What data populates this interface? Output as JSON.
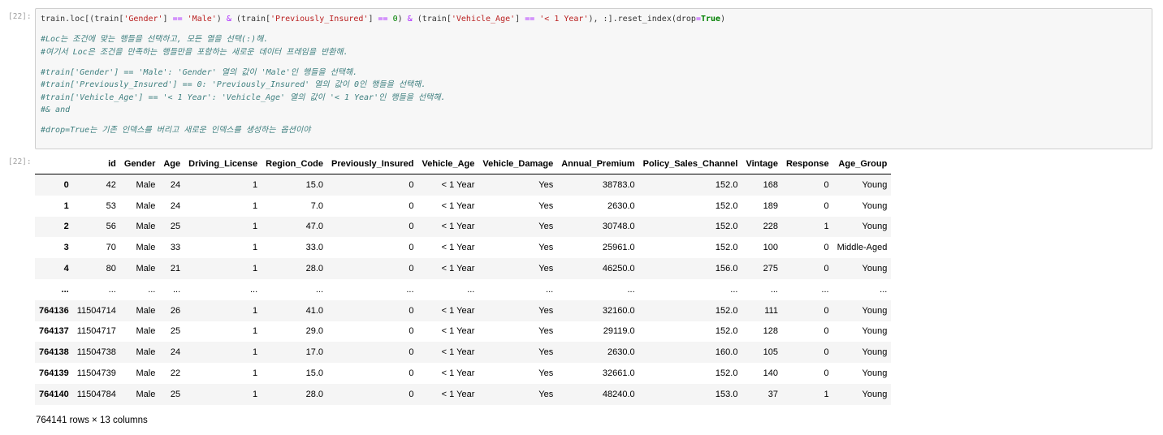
{
  "input_prompt": "[22]:",
  "output_prompt": "[22]:",
  "code_lines": [
    {
      "type": "code",
      "parts": [
        {
          "t": "train.loc[(train[",
          "c": ""
        },
        {
          "t": "'Gender'",
          "c": "s"
        },
        {
          "t": "] ",
          "c": ""
        },
        {
          "t": "==",
          "c": "o"
        },
        {
          "t": " ",
          "c": ""
        },
        {
          "t": "'Male'",
          "c": "s"
        },
        {
          "t": ") ",
          "c": ""
        },
        {
          "t": "&",
          "c": "o"
        },
        {
          "t": " (train[",
          "c": ""
        },
        {
          "t": "'Previously_Insured'",
          "c": "s"
        },
        {
          "t": "] ",
          "c": ""
        },
        {
          "t": "==",
          "c": "o"
        },
        {
          "t": " ",
          "c": ""
        },
        {
          "t": "0",
          "c": "m"
        },
        {
          "t": ") ",
          "c": ""
        },
        {
          "t": "&",
          "c": "o"
        },
        {
          "t": " (train[",
          "c": ""
        },
        {
          "t": "'Vehicle_Age'",
          "c": "s"
        },
        {
          "t": "] ",
          "c": ""
        },
        {
          "t": "==",
          "c": "o"
        },
        {
          "t": " ",
          "c": ""
        },
        {
          "t": "'< 1 Year'",
          "c": "s"
        },
        {
          "t": "), :].reset_index(drop",
          "c": ""
        },
        {
          "t": "=",
          "c": "o"
        },
        {
          "t": "True",
          "c": "k"
        },
        {
          "t": ")",
          "c": ""
        }
      ]
    },
    {
      "type": "blank"
    },
    {
      "type": "comment",
      "text": "#Loc는 조건에 맞는 행들을 선택하고, 모든 열을 선택(:)해."
    },
    {
      "type": "comment",
      "text": "#여기서 Loc은 조건을 만족하는 행들만을 포함하는 새로운 데이터 프레임을 반환해."
    },
    {
      "type": "blank"
    },
    {
      "type": "comment",
      "text": "#train['Gender'] == 'Male': 'Gender' 열의 값이 'Male'인 행들을 선택해."
    },
    {
      "type": "comment",
      "text": "#train['Previously_Insured'] == 0: 'Previously_Insured' 열의 값이 0인 행들을 선택해."
    },
    {
      "type": "comment",
      "text": "#train['Vehicle_Age'] == '< 1 Year': 'Vehicle_Age' 열의 값이 '< 1 Year'인 행들을 선택해."
    },
    {
      "type": "comment",
      "text": "#& and"
    },
    {
      "type": "blank"
    },
    {
      "type": "comment",
      "text": "#drop=True는 기존 인덱스를 버리고 새로운 인덱스를 생성하는 옵션이야"
    }
  ],
  "table": {
    "columns": [
      "id",
      "Gender",
      "Age",
      "Driving_License",
      "Region_Code",
      "Previously_Insured",
      "Vehicle_Age",
      "Vehicle_Damage",
      "Annual_Premium",
      "Policy_Sales_Channel",
      "Vintage",
      "Response",
      "Age_Group"
    ],
    "rows": [
      {
        "index": "0",
        "cells": [
          "42",
          "Male",
          "24",
          "1",
          "15.0",
          "0",
          "< 1 Year",
          "Yes",
          "38783.0",
          "152.0",
          "168",
          "0",
          "Young"
        ]
      },
      {
        "index": "1",
        "cells": [
          "53",
          "Male",
          "24",
          "1",
          "7.0",
          "0",
          "< 1 Year",
          "Yes",
          "2630.0",
          "152.0",
          "189",
          "0",
          "Young"
        ]
      },
      {
        "index": "2",
        "cells": [
          "56",
          "Male",
          "25",
          "1",
          "47.0",
          "0",
          "< 1 Year",
          "Yes",
          "30748.0",
          "152.0",
          "228",
          "1",
          "Young"
        ]
      },
      {
        "index": "3",
        "cells": [
          "70",
          "Male",
          "33",
          "1",
          "33.0",
          "0",
          "< 1 Year",
          "Yes",
          "25961.0",
          "152.0",
          "100",
          "0",
          "Middle-Aged"
        ]
      },
      {
        "index": "4",
        "cells": [
          "80",
          "Male",
          "21",
          "1",
          "28.0",
          "0",
          "< 1 Year",
          "Yes",
          "46250.0",
          "156.0",
          "275",
          "0",
          "Young"
        ]
      },
      {
        "index": "...",
        "cells": [
          "...",
          "...",
          "...",
          "...",
          "...",
          "...",
          "...",
          "...",
          "...",
          "...",
          "...",
          "...",
          "..."
        ]
      },
      {
        "index": "764136",
        "cells": [
          "11504714",
          "Male",
          "26",
          "1",
          "41.0",
          "0",
          "< 1 Year",
          "Yes",
          "32160.0",
          "152.0",
          "111",
          "0",
          "Young"
        ]
      },
      {
        "index": "764137",
        "cells": [
          "11504717",
          "Male",
          "25",
          "1",
          "29.0",
          "0",
          "< 1 Year",
          "Yes",
          "29119.0",
          "152.0",
          "128",
          "0",
          "Young"
        ]
      },
      {
        "index": "764138",
        "cells": [
          "11504738",
          "Male",
          "24",
          "1",
          "17.0",
          "0",
          "< 1 Year",
          "Yes",
          "2630.0",
          "160.0",
          "105",
          "0",
          "Young"
        ]
      },
      {
        "index": "764139",
        "cells": [
          "11504739",
          "Male",
          "22",
          "1",
          "15.0",
          "0",
          "< 1 Year",
          "Yes",
          "32661.0",
          "152.0",
          "140",
          "0",
          "Young"
        ]
      },
      {
        "index": "764140",
        "cells": [
          "11504784",
          "Male",
          "25",
          "1",
          "28.0",
          "0",
          "< 1 Year",
          "Yes",
          "48240.0",
          "153.0",
          "37",
          "1",
          "Young"
        ]
      }
    ]
  },
  "shape_text": "764141 rows × 13 columns"
}
